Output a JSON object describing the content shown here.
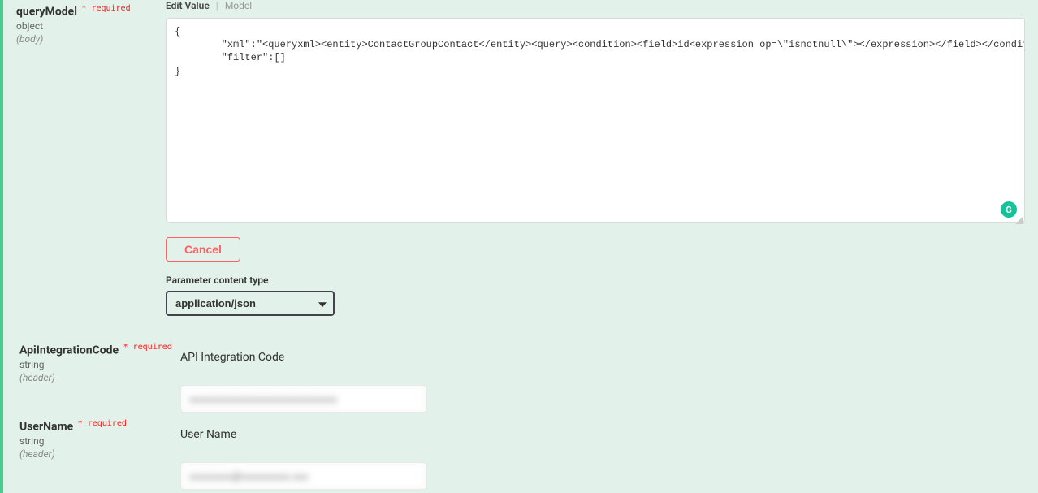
{
  "params": {
    "queryModel": {
      "name": "queryModel",
      "required_text": "required",
      "type": "object",
      "in": "(body)"
    },
    "apiIntegrationCode": {
      "name": "ApiIntegrationCode",
      "required_text": "required",
      "type": "string",
      "in": "(header)",
      "label": "API Integration Code",
      "value": "xxxxxxxxxxxxxxxxxxxxxxxxxxxx"
    },
    "userName": {
      "name": "UserName",
      "required_text": "required",
      "type": "string",
      "in": "(header)",
      "label": "User Name",
      "value": "xxxxxxxx@xxxxxxxxx.xxx"
    }
  },
  "editor": {
    "tab_edit": "Edit Value",
    "tab_model": "Model",
    "body_text": "{\n        \"xml\":\"<queryxml><entity>ContactGroupContact</entity><query><condition><field>id<expression op=\\\"isnotnull\\\"></expression></field></condition></query></queryxml>\",\n        \"filter\":[]\n}"
  },
  "buttons": {
    "cancel": "Cancel"
  },
  "content_type": {
    "label": "Parameter content type",
    "selected": "application/json"
  },
  "grammarly_letter": "G"
}
